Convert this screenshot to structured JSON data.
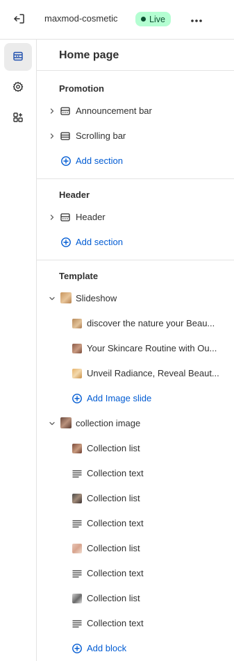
{
  "topbar": {
    "store_name": "maxmod-cosmetic",
    "status_badge": "Live"
  },
  "panel": {
    "title": "Home page",
    "groups": {
      "promotion": {
        "title": "Promotion",
        "items": [
          "Announcement bar",
          "Scrolling bar"
        ],
        "add_label": "Add section"
      },
      "header": {
        "title": "Header",
        "items": [
          "Header"
        ],
        "add_label": "Add section"
      },
      "template": {
        "title": "Template",
        "slideshow": {
          "label": "Slideshow",
          "slides": [
            "discover the nature your Beau...",
            "Your Skincare Routine with Ou...",
            "Unveil Radiance, Reveal Beaut..."
          ],
          "add_label": "Add Image slide"
        },
        "collection_image": {
          "label": "collection image",
          "blocks": [
            "Collection list",
            "Collection text",
            "Collection list",
            "Collection text",
            "Collection list",
            "Collection text",
            "Collection list",
            "Collection text"
          ],
          "add_label": "Add block"
        }
      }
    }
  },
  "colors": {
    "accent": "#005bd3",
    "live_badge_bg": "#b4fed2",
    "live_badge_text": "#0c5132"
  },
  "icons": {
    "exit": "exit-icon",
    "more": "more-horizontal-icon",
    "sections": "sections-icon",
    "settings": "gear-icon",
    "apps": "apps-add-icon"
  }
}
